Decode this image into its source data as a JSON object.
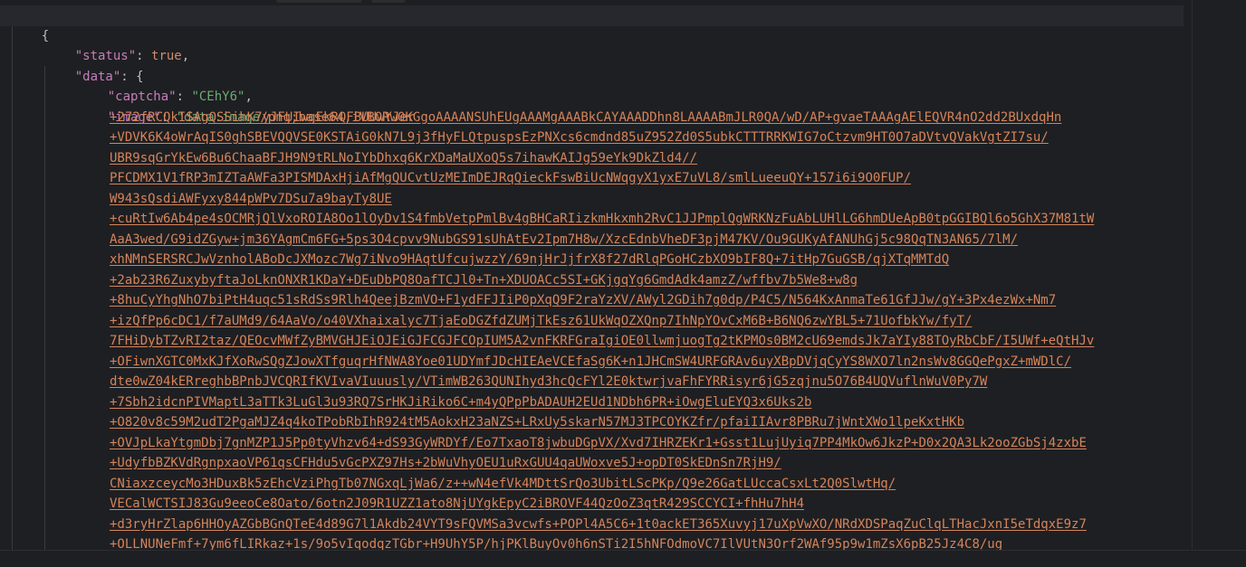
{
  "json": {
    "open_brace": "{",
    "status_key": "\"status\"",
    "status_value": "true",
    "data_key": "\"data\"",
    "data_brace": "{",
    "captcha_key": "\"captcha\"",
    "captcha_value": "\"CEhY6\"",
    "image_key": "\"image\"",
    "image_prefix": "\"data:image",
    "image_lines": [
      "/png;base64,iVBORw0KGgoAAAANSUhEUgAAAMgAAABkCAYAAADDhn8LAAAABmJLR0QA/wD/AP+gvaeTAAAgAElEQVR4nO2dd2BUxdqHn",
      "+272fRCQkISAgQSSihK7yJFUIwgEkRQFBUUwYJer",
      "+VDVK6K4oWrAqIS0ghSBEVQQVSE0KSTAiG0kN7L9j3fHyFLQtpuspsEzPNXcs6cmdnd85uZ952Zd0S5ubkCTTTRRKWIG7oCtzvm9HT0O7aDVtvQVakVgtZI7su/",
      "UBR9sqGrYkEw6Bu6ChaaBFJH9N9tRLNoIYbDhxq6KrXDaMaUXoQ5s7ihawKAIJg59eYk9DkZld4//",
      "PFCDMX1V1fRP3mIZTaAWFa3PISMDAxHjiAfMgQUCvtUzMEImDEJRqQieckFswBiUcNWqgyX1yxE7uVL8/smlLueeuQY+157i6i9O0FUP/",
      "W943sQsdiAWFyxy844pWPv7DSu7a9bayTy8UE",
      "+cuRtIw6Ab4pe4sOCMRjQlVxoROIA8Oo1lOyDv1S4fmbVetpPmlBv4gBHCaRIizkmHkxmh2RvC1JJPmplQgWRKNzFuAbLUHlLG6hmDUeApB0tpGGIBQl6o5GhX37M81tW",
      "AaA3wed/G9idZGyw+jm36YAgmCm6FG+5ps3O4cpvv9NubGS91sUhAtEv2Ipm7H8w/XzcEdnbVheDF3pjM47KV/Ou9GUKyAfANUhGj5c98QqTN3AN65/7lM/",
      "xhNMnSERSRCJwVznholABoDcJXMozc7Wg7iNvo9HAqtUfcujwzzY/69njHrJjfrX8f27dRlqPGoHCzbXO9bIF8Q+7itHp7GuGSB/qjXTqMMTdQ",
      "+2ab23R6ZuxybyftaJoLknONXR1KDaY+DEuDbPQ8OafTCJl0+Tn+XDUOACc5SI+GKjgqYg6GmdAdk4amzZ/wffbv7b5We8+w8g",
      "+8huCyYhgNhO7biPtH4uqc51sRdSs9Rlh4QeejBzmVO+F1ydFFJIiP0pXqQ9F2raYzXV/AWyl2GDih7g0dp/P4C5/N564KxAnmaTe61GfJJw/gY+3Px4ezWx+Nm7",
      "+izQfPp6cDC1/f7aUMd9/64AaVo/o40VXhaixalyc7TjaEoDGZfdZUMjTkEsz61UkWqOZXQnp7IhNpYOvCxM6B+B6NQ6zwYBL5+71UofbkYw/fyT/",
      "7FHiDybTZvRI2taz/QEOcvMWfZyBMVGHJEiOJEiGJFCGJFCOpIUM5A2vnFKRFGraIgiOE0llwmjuogTg2tKPMOs0BM2cU69emdsJk7aYIy88TOyRbCbF/I5UWf+eQtHJv",
      "+OFiwnXGTC0MxKJfXoRwSQgZJowXTfguqrHfNWA8Yoe01UDYmfJDcHIEAeVCEfaSg6K+n1JHCmSW4URFGRAv6uyXBpDVjqCyYS8WXO7ln2nsWv8GGQePgxZ+mWDlC/",
      "dte0wZ04kERreghbBPnbJVCQRIfKVIvaVIuuusly/VTimWB263QUNIhyd3hcQcFYl2E0ktwrjvaFhFYRRisyr6jG5zqjnu5O76B4UQVuflnWuV0Py7W",
      "+7Sbh2idcnPIVMaptL3aTTk3LuGl3u93RQ7SrHKJiRiko6C+m4yQPpPbADAUH2EUd1NDbh6PR+iOwgEluEYQ3x6Uks2b",
      "+O820v8c59M2udT2PgaMJZ4q4koTPobRbIhR924tM5AokxH23aNZS+LRxUy5skarN57MJ3TPCOYKZfr/pfaiIIAvr8PBRu7jWntXWo1lpeKxtHKb",
      "+OVJpLkaYtgmDbj7gnMZP1J5Pp0tyVhzv64+dS93GyWRDYf/Eo7TxaoT8jwbuDGpVX/Xvd7IHRZEKr1+Gsst1LujUyiq7PP4MkOw6JkzP+D0x2QA3Lk2ooZGbSj4zxbE",
      "+UdyfbBZKVdRgnpxaoVP61qsCFHdu5vGcPXZ97Hs+2bWuVhyOEU1uRxGUU4qaUWoxve5J+opDT0SkEDnSn7RjH9/",
      "CNiaxzceycMo3HDuxBk5zEhcVziPhgTb07NGxqLjWa6/z++wN4efVk4MDttSrQo3UbitLScPKp/Q9e26GatLUccaCsxLt2Q0SlwtHq/",
      "VECalWCTSIJ83Gu9eeoCe8Oato/6otn2J09R1UZZ1ato8NjUYgkEpyC2iBROVF44QzOoZ3qtR429SCCYCI+fhHu7hH4",
      "+d3ryHrZlap6HHOyAZGbBGnQTeE4d89G7l1Akdb24VYT9sFQVMSa3vcwfs+POPl4A5C6+1t0ackET365Xuvyj17uXpVwXO/NRdXDSPaqZuClqLTHacJxnI5eTdqxE9z7",
      "+OLLNUNeFmf+7ym6fLIRkaz+1s/9o5vIqodqzTGbr+H9UhY5P/hjPKlBuyOv0h6nSTi2I5hNFOdmoVC7IlVUtN3Orf2WAf95p9w1mZsX6pB25Jz4C8/ug"
    ]
  },
  "colors": {
    "background": "#1e1f22",
    "key": "#c77dbb",
    "keyword": "#cf8e6d",
    "string": "#6aab73",
    "url": "#d5845a",
    "text": "#bcbec4"
  }
}
